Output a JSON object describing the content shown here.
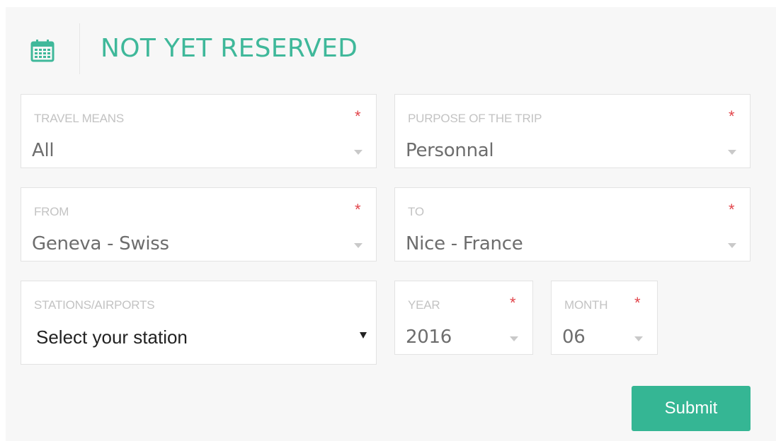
{
  "header": {
    "title": "NOT YET RESERVED",
    "icon": "calendar-icon",
    "accent_color": "#3fb89a"
  },
  "fields": {
    "travel_means": {
      "label": "TRAVEL MEANS",
      "value": "All",
      "required_mark": "*"
    },
    "purpose": {
      "label": "PURPOSE OF THE TRIP",
      "value": "Personnal",
      "required_mark": "*"
    },
    "from": {
      "label": "FROM",
      "value": "Geneva - Swiss",
      "required_mark": "*"
    },
    "to": {
      "label": "TO",
      "value": "Nice - France",
      "required_mark": "*"
    },
    "stations": {
      "label": "STATIONS/AIRPORTS",
      "value": "Select your station"
    },
    "year": {
      "label": "YEAR",
      "value": "2016",
      "required_mark": "*"
    },
    "month": {
      "label": "MONTH",
      "value": "06",
      "required_mark": "*"
    }
  },
  "actions": {
    "submit_label": "Submit"
  },
  "colors": {
    "required": "#e2454b",
    "button": "#35b694"
  }
}
